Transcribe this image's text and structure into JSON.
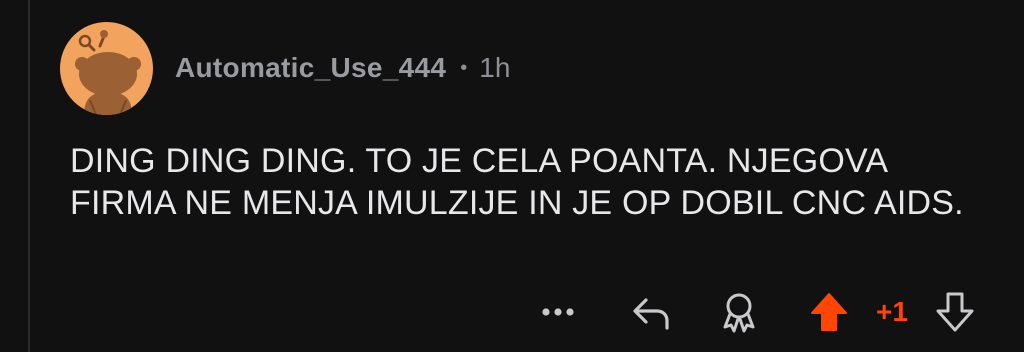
{
  "comment": {
    "author": "Automatic_Use_444",
    "separator": "•",
    "age": "1h",
    "body": "DING DING DING. TO JE CELA POANTA. NJEGOVA FIRMA NE MENJA IMULZIJE IN JE OP DOBIL CNC AIDS.",
    "score": "+1",
    "vote_state": "upvoted"
  },
  "actions": {
    "more_icon": "more-icon",
    "reply_icon": "reply-icon",
    "award_icon": "award-icon",
    "upvote_icon": "upvote-icon",
    "downvote_icon": "downvote-icon"
  },
  "colors": {
    "background": "#111112",
    "upvote_accent": "#ff4500",
    "avatar_background": "#f2a35e",
    "meta_text": "#8f9095"
  }
}
